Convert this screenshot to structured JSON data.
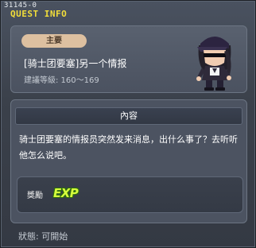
{
  "quest": {
    "id": "31145-0",
    "window_title": "QUEST INFO",
    "category_tag": "主要",
    "name": "[骑士团要塞]另一个情报",
    "level_requirement": "建議等級: 160～169",
    "content_header": "內容",
    "description": "骑士团要塞的情报员突然发来消息，出什么事了？去听听他怎么说吧。",
    "reward_label": "獎勵",
    "reward_exp": "EXP",
    "status": "狀態: 可開始"
  },
  "colors": {
    "title_yellow": "#f2de3a",
    "tag_bg": "#ddc0a0",
    "exp_green": "#d7ff3d"
  },
  "icons": {
    "npc": "npc-portrait-icon",
    "exp": "exp-icon"
  }
}
